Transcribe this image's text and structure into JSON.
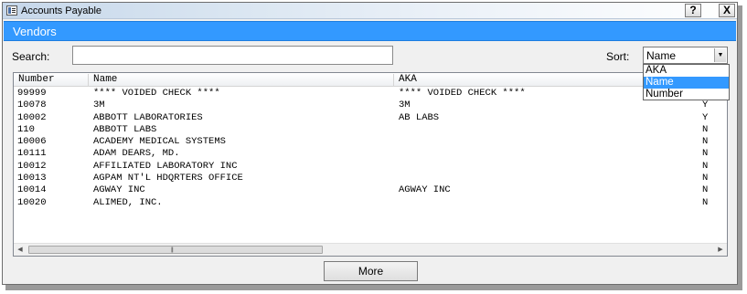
{
  "window": {
    "title": "Accounts Payable",
    "help_label": "?",
    "close_label": "X"
  },
  "header": {
    "title": "Vendors"
  },
  "search": {
    "label": "Search:",
    "value": "",
    "placeholder": ""
  },
  "sort": {
    "label": "Sort:",
    "selected": "Name",
    "options": [
      "AKA",
      "Name",
      "Number"
    ],
    "dropdown_open": true
  },
  "table": {
    "columns": [
      "Number",
      "Name",
      "AKA"
    ],
    "rows": [
      {
        "number": "99999",
        "name": "**** VOIDED CHECK ****",
        "aka": "**** VOIDED CHECK ****",
        "flag": ""
      },
      {
        "number": "10078",
        "name": "3M",
        "aka": "3M",
        "flag": "Y"
      },
      {
        "number": "10002",
        "name": "ABBOTT LABORATORIES",
        "aka": "AB LABS",
        "flag": "Y"
      },
      {
        "number": "110",
        "name": "ABBOTT LABS",
        "aka": "",
        "flag": "N"
      },
      {
        "number": "10006",
        "name": "ACADEMY MEDICAL SYSTEMS",
        "aka": "",
        "flag": "N"
      },
      {
        "number": "10111",
        "name": "ADAM DEARS, MD.",
        "aka": "",
        "flag": "N"
      },
      {
        "number": "10012",
        "name": "AFFILIATED LABORATORY INC",
        "aka": "",
        "flag": "N"
      },
      {
        "number": "10013",
        "name": "AGPAM NT'L HDQRTERS OFFICE",
        "aka": "",
        "flag": "N"
      },
      {
        "number": "10014",
        "name": "AGWAY INC",
        "aka": "AGWAY INC",
        "flag": "N"
      },
      {
        "number": "10020",
        "name": "ALIMED, INC.",
        "aka": "",
        "flag": "N"
      }
    ]
  },
  "footer": {
    "more_label": "More"
  },
  "colors": {
    "header_blue": "#3399ff",
    "selection_blue": "#3399ff"
  }
}
